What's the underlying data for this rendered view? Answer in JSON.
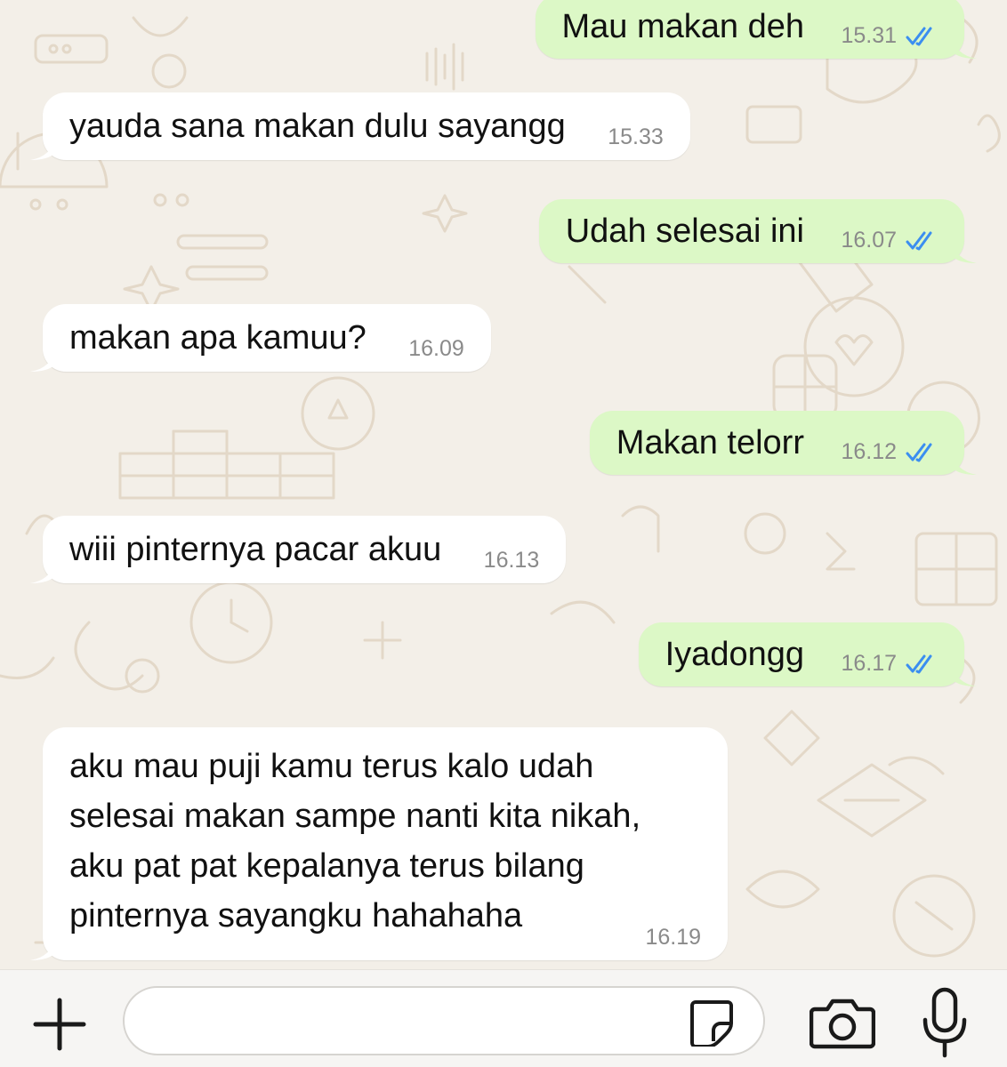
{
  "chat": {
    "messages": [
      {
        "direction": "out",
        "text": "Mau makan deh",
        "time": "15.31",
        "status": "read"
      },
      {
        "direction": "in",
        "text": "yauda sana makan dulu sayangg",
        "time": "15.33"
      },
      {
        "direction": "out",
        "text": "Udah selesai ini",
        "time": "16.07",
        "status": "read"
      },
      {
        "direction": "in",
        "text": "makan apa kamuu?",
        "time": "16.09"
      },
      {
        "direction": "out",
        "text": "Makan telorr",
        "time": "16.12",
        "status": "read"
      },
      {
        "direction": "in",
        "text": "wiii pinternya pacar akuu",
        "time": "16.13"
      },
      {
        "direction": "out",
        "text": "Iyadongg",
        "time": "16.17",
        "status": "read"
      },
      {
        "direction": "in",
        "text": "aku mau puji kamu terus kalo udah\nselesai makan sampe nanti kita nikah,\naku pat pat kepalanya terus bilang\npinternya sayangku hahahaha",
        "time": "16.19"
      }
    ]
  },
  "composer": {
    "input_value": "",
    "icons": {
      "attach": "plus-icon",
      "sticker": "sticker-icon",
      "camera": "camera-icon",
      "voice": "microphone-icon"
    }
  },
  "colors": {
    "background": "#f3efe8",
    "incoming_bubble": "#ffffff",
    "outgoing_bubble": "#dcf8c6",
    "read_ticks": "#3b8ef0",
    "timestamp": "#8a8a8a"
  }
}
